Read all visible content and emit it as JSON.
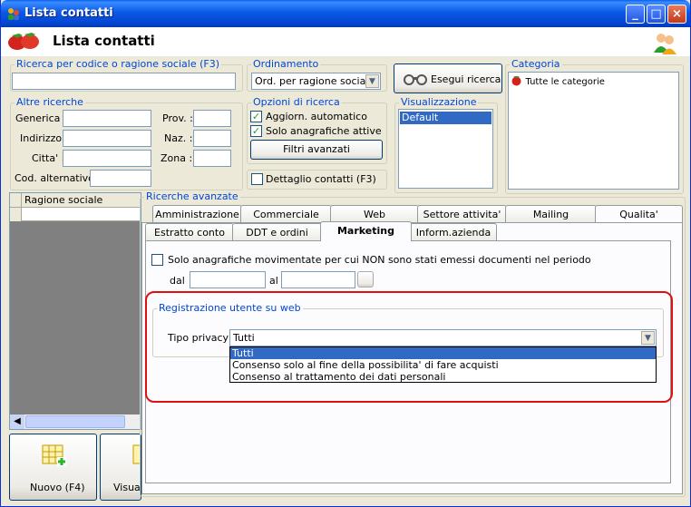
{
  "window": {
    "title": "Lista contatti",
    "header_title": "Lista contatti",
    "controls": {
      "minimize": "_",
      "maximize": "□",
      "close": "×"
    }
  },
  "search_code": {
    "legend": "Ricerca per codice o ragione sociale (F3)",
    "value": ""
  },
  "ordering": {
    "legend": "Ordinamento",
    "selected": "Ord. per ragione sociale"
  },
  "search_button": {
    "label": "Esegui ricerca"
  },
  "category": {
    "legend": "Categoria",
    "items": [
      "Tutte le categorie"
    ]
  },
  "other_searches": {
    "legend": "Altre ricerche",
    "fields": {
      "generica": "Generica :",
      "indirizzo": "Indirizzo :",
      "citta": "Citta' :",
      "cod_alternativo": "Cod. alternativo :",
      "prov": "Prov. :",
      "naz": "Naz. :",
      "zona": "Zona :"
    }
  },
  "search_options": {
    "legend": "Opzioni di ricerca",
    "aggiorn": "Aggiorn. automatico",
    "solo_attive": "Solo anagrafiche attive",
    "filtri_button": "Filtri avanzati",
    "aggiorn_checked": true,
    "solo_attive_checked": true
  },
  "detail_contacts": {
    "label": "Dettaglio contatti (F3)",
    "checked": false
  },
  "view": {
    "legend": "Visualizzazione",
    "items": [
      "Default"
    ]
  },
  "grid": {
    "column": "Ragione sociale"
  },
  "bottom_buttons": {
    "new_label": "Nuovo (F4)",
    "view_label": "Visual"
  },
  "advanced": {
    "legend": "Ricerche avanzate",
    "tabs_row1": [
      "Amministrazione",
      "Commerciale",
      "Web",
      "Settore attivita'",
      "Mailing",
      "Qualita'"
    ],
    "tabs_row2": [
      "Estratto conto",
      "DDT e ordini",
      "Marketing",
      "Inform.azienda"
    ],
    "active_tab": "Marketing",
    "solo_movimentate": "Solo anagrafiche movimentate per cui NON sono stati emessi documenti nel periodo",
    "dal": "dal",
    "al": "al",
    "registration": {
      "legend": "Registrazione utente su web",
      "privacy_label": "Tipo privacy :",
      "privacy_selected": "Tutti",
      "privacy_options": [
        "Tutti",
        "Consenso solo al fine della possibilita' di fare acquisti",
        "Consenso al trattamento dei dati personali"
      ]
    }
  },
  "colors": {
    "highlight": "#e01010",
    "selection": "#316ac5",
    "legend": "#0046d5"
  }
}
